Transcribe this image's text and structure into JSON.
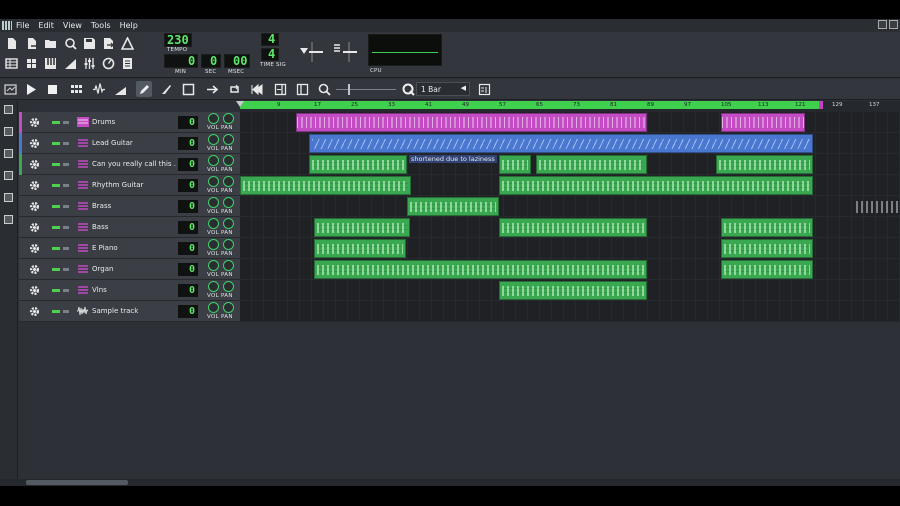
{
  "menu": [
    "File",
    "Edit",
    "View",
    "Tools",
    "Help"
  ],
  "transport": {
    "tempo": "230",
    "tempo_label": "TEMPO",
    "min": "0",
    "min_label": "MIN",
    "sec": "0",
    "sec_label": "SEC",
    "msec": "00",
    "msec_label": "MSEC",
    "timesig_num": "4",
    "timesig_den": "4",
    "timesig_label": "TIME SIG",
    "cpu_label": "CPU"
  },
  "editor_toolbar": {
    "quantize": "1 Bar"
  },
  "timeline": {
    "ticks": [
      "9",
      "17",
      "25",
      "33",
      "41",
      "49",
      "57",
      "65",
      "73",
      "81",
      "89",
      "97",
      "105",
      "113",
      "121",
      "129",
      "137"
    ]
  },
  "tracks": [
    {
      "name": "Drums",
      "volume": "0",
      "type": "beat"
    },
    {
      "name": "Lead Guitar",
      "volume": "0",
      "type": "inst"
    },
    {
      "name": "Can you really call this ...",
      "volume": "0",
      "type": "inst"
    },
    {
      "name": "Rhythm Guitar",
      "volume": "0",
      "type": "inst"
    },
    {
      "name": "Brass",
      "volume": "0",
      "type": "inst"
    },
    {
      "name": "Bass",
      "volume": "0",
      "type": "inst"
    },
    {
      "name": "E Piano",
      "volume": "0",
      "type": "inst"
    },
    {
      "name": "Organ",
      "volume": "0",
      "type": "inst"
    },
    {
      "name": "Vlns",
      "volume": "0",
      "type": "inst"
    },
    {
      "name": "Sample track",
      "volume": "0",
      "type": "sample"
    }
  ],
  "vol_pan_label": "VOL PAN",
  "comment": "shortened due to laziness",
  "colors": {
    "beat": "#c34bc4",
    "inst": "#3aa851",
    "lead": "#4a78d1",
    "ruler": "#3fd04d",
    "lcd": "#5de86a"
  }
}
